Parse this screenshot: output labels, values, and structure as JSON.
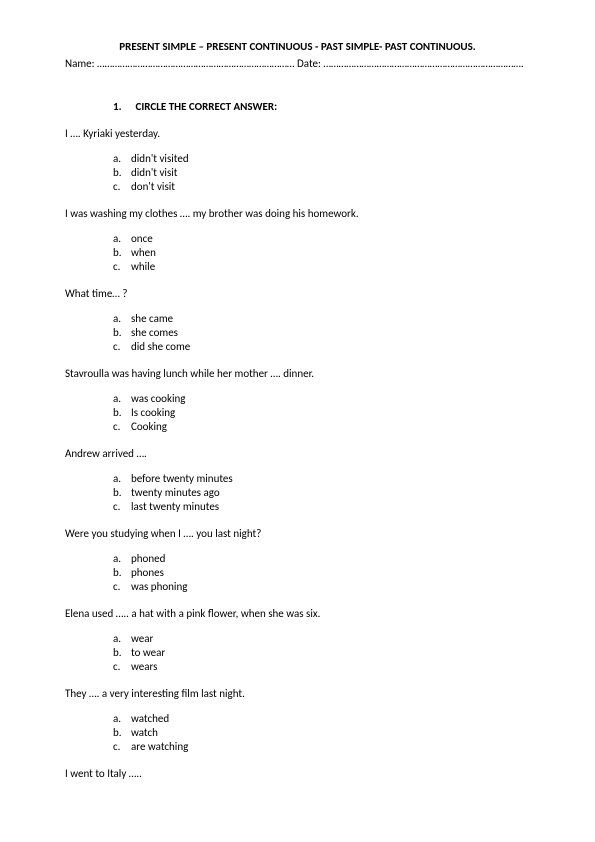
{
  "header": {
    "title": "PRESENT SIMPLE – PRESENT CONTINUOUS - PAST SIMPLE- PAST CONTINUOUS.",
    "name_label": "Name: ……………………………………………………………………",
    "date_label": "Date: ……………………………………………………………………."
  },
  "section": {
    "number": "1.",
    "heading": "CIRCLE THE CORRECT ANSWER:"
  },
  "questions": [
    {
      "text": "I …. Kyriaki yesterday.",
      "options": [
        "didn't visited",
        "didn't visit",
        "don't visit"
      ]
    },
    {
      "text": "I was washing my clothes …. my brother was doing his homework.",
      "options": [
        "once",
        "when",
        "while"
      ]
    },
    {
      "text": "What time… ?",
      "options": [
        "she came",
        "she comes",
        "did she come"
      ]
    },
    {
      "text": "Stavroulla was having lunch while her mother …. dinner.",
      "options": [
        "was cooking",
        "Is cooking",
        "Cooking"
      ]
    },
    {
      "text": "Andrew arrived ….",
      "options": [
        "before twenty minutes",
        "twenty minutes ago",
        "last twenty minutes"
      ]
    },
    {
      "text": "Were you studying when I …. you last night?",
      "options": [
        "phoned",
        "phones",
        "was phoning"
      ]
    },
    {
      "text": "Elena used ….. a hat with a pink flower, when she was six.",
      "options": [
        "wear",
        "to wear",
        "wears"
      ]
    },
    {
      "text": "They …. a very interesting film last night.",
      "options": [
        "watched",
        "watch",
        "are watching"
      ]
    },
    {
      "text": "I went to Italy …..",
      "options": []
    }
  ],
  "option_letters": [
    "a.",
    "b.",
    "c."
  ]
}
